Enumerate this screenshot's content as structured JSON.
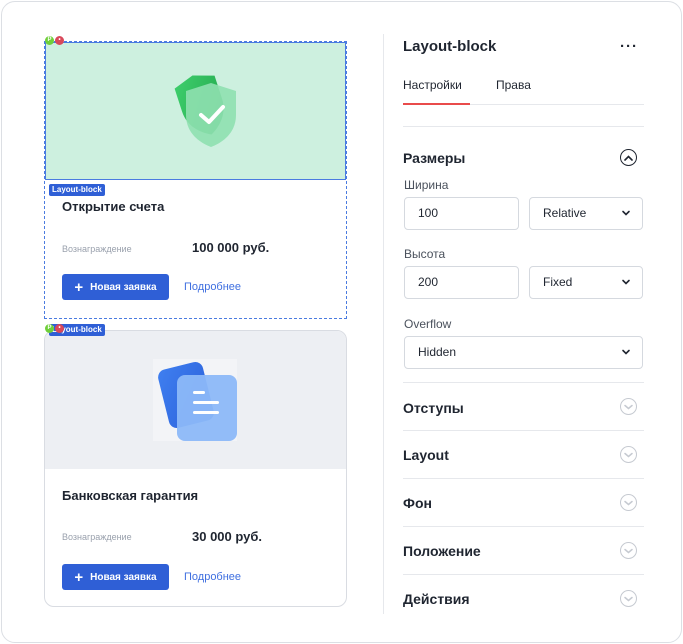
{
  "canvas": {
    "card1": {
      "tag": "Layout-block",
      "title": "Открытие счета",
      "reward_label": "Вознаграждение",
      "reward_value": "100 000 руб.",
      "button_label": "Новая заявка",
      "link_label": "Подробнее"
    },
    "card2": {
      "tag": "Layout-block",
      "title": "Банковская гарантия",
      "reward_label": "Вознаграждение",
      "reward_value": "30 000 руб.",
      "button_label": "Новая заявка",
      "link_label": "Подробнее"
    },
    "badge_p": "P",
    "badge_lock": "🔒"
  },
  "panel": {
    "title": "Layout-block",
    "more": "···",
    "tabs": [
      {
        "label": "Настройки",
        "active": true
      },
      {
        "label": "Права",
        "active": false
      }
    ],
    "sizes": {
      "title": "Размеры",
      "width_label": "Ширина",
      "width_value": "100",
      "width_unit": "Relative",
      "height_label": "Высота",
      "height_value": "200",
      "height_unit": "Fixed",
      "overflow_label": "Overflow",
      "overflow_value": "Hidden"
    },
    "sections": [
      "Отступы",
      "Layout",
      "Фон",
      "Положение",
      "Действия"
    ]
  },
  "colors": {
    "accent": "#2f5fd6",
    "tab_underline": "#e94b4b",
    "media_green": "#cdf0df",
    "media_gray": "#edeff3"
  }
}
